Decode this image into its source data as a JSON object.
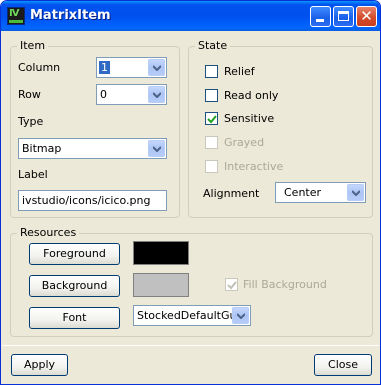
{
  "window": {
    "title": "MatrixItem"
  },
  "item": {
    "group_title": "Item",
    "column_label": "Column",
    "column_value": "1",
    "row_label": "Row",
    "row_value": "0",
    "type_label": "Type",
    "type_value": "Bitmap",
    "label_label": "Label",
    "label_value": "ivstudio/icons/icico.png"
  },
  "state": {
    "group_title": "State",
    "relief": {
      "label": "Relief",
      "checked": false,
      "enabled": true
    },
    "read_only": {
      "label": "Read only",
      "checked": false,
      "enabled": true
    },
    "sensitive": {
      "label": "Sensitive",
      "checked": true,
      "enabled": true
    },
    "grayed": {
      "label": "Grayed",
      "checked": false,
      "enabled": false
    },
    "interactive": {
      "label": "Interactive",
      "checked": false,
      "enabled": false
    },
    "alignment_label": "Alignment",
    "alignment_value": "Center"
  },
  "resources": {
    "group_title": "Resources",
    "foreground_label": "Foreground",
    "foreground_color": "#000000",
    "background_label": "Background",
    "background_color": "#c0c0c0",
    "fill_background": {
      "label": "Fill Background",
      "checked": true,
      "enabled": false
    },
    "font_label": "Font",
    "font_value": "StockedDefaultGui"
  },
  "footer": {
    "apply_label": "Apply",
    "close_label": "Close"
  }
}
